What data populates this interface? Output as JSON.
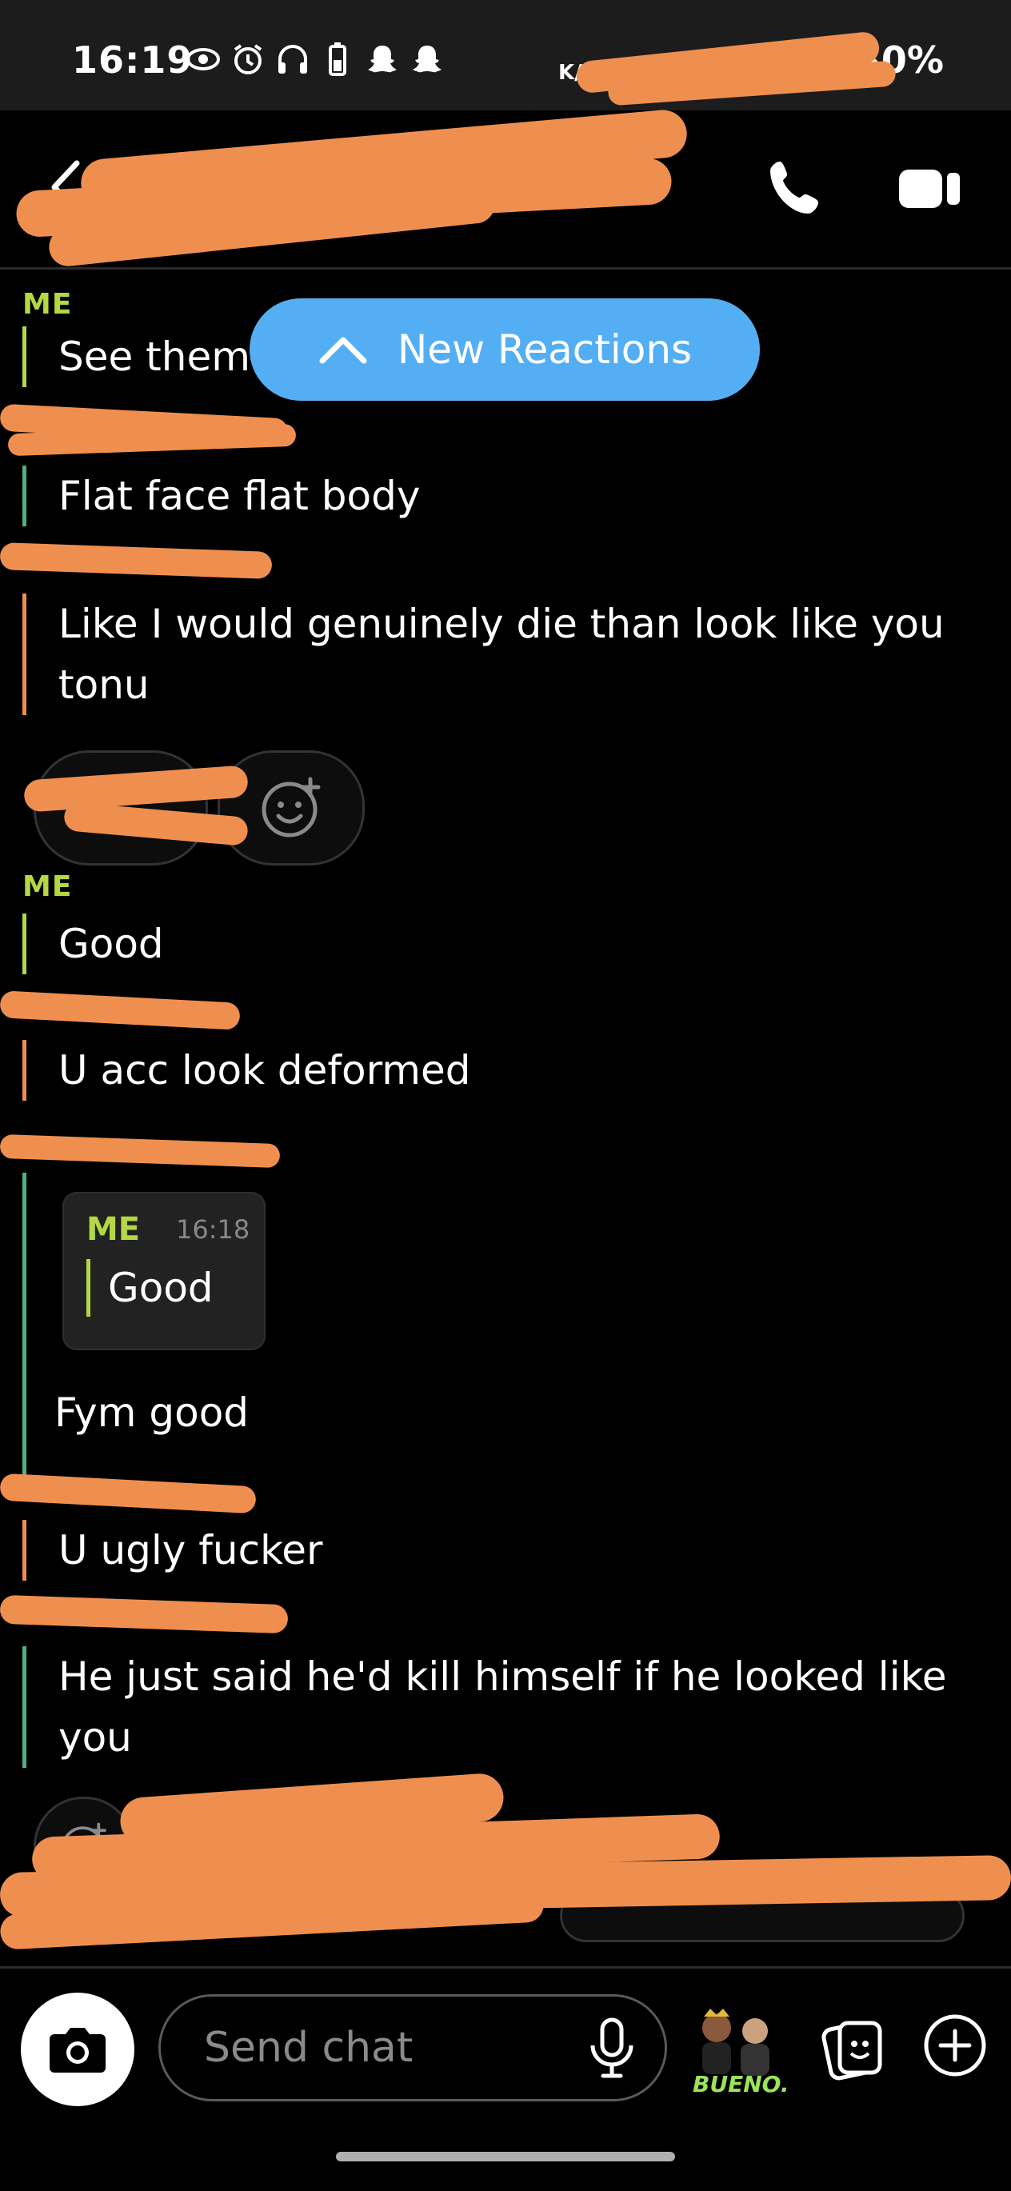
{
  "status_bar": {
    "time": "16:19",
    "battery_text": "30%",
    "network_speed_label": "K/S",
    "icons": [
      "eye-icon",
      "alarm-icon",
      "headphones-icon",
      "battery-icon",
      "snapchat-ghost-icon",
      "snapchat-ghost-icon"
    ]
  },
  "header": {
    "contact_name": "",
    "icons": [
      "back-chevron-icon",
      "phone-icon",
      "video-camera-icon"
    ]
  },
  "new_reactions": {
    "label": "New Reactions",
    "icon": "chevron-up-icon"
  },
  "messages": [
    {
      "sender": "ME",
      "text": "See them",
      "color": "#b3d844"
    },
    {
      "sender": "",
      "text": "Flat face flat body",
      "color": "#4fb083"
    },
    {
      "sender": "",
      "text": "Like I would genuinely die than look like you tonu",
      "color": "#f28d4f"
    },
    {
      "sender": "ME",
      "text": "Good",
      "color": "#b3d844"
    },
    {
      "sender": "",
      "text": "U acc look deformed",
      "color": "#f28d4f"
    },
    {
      "sender": "",
      "text": "Fym good",
      "color": "#4fb083",
      "quote": {
        "sender": "ME",
        "time": "16:18",
        "text": "Good"
      }
    },
    {
      "sender": "",
      "text": "U ugly fucker",
      "color": "#f28d4f"
    },
    {
      "sender": "",
      "text": "He just said he'd kill himself if he looked like you",
      "color": "#4fb083"
    }
  ],
  "reactions": {
    "add_icon": "add-reaction-icon"
  },
  "composer": {
    "placeholder": "Send chat",
    "bitmoji_caption": "BUENO."
  },
  "colors": {
    "me": "#b3d844",
    "friend_green": "#4fb083",
    "friend_orange": "#f28d4f",
    "accent_blue": "#54aef3",
    "redaction": "#ef8f4f"
  }
}
